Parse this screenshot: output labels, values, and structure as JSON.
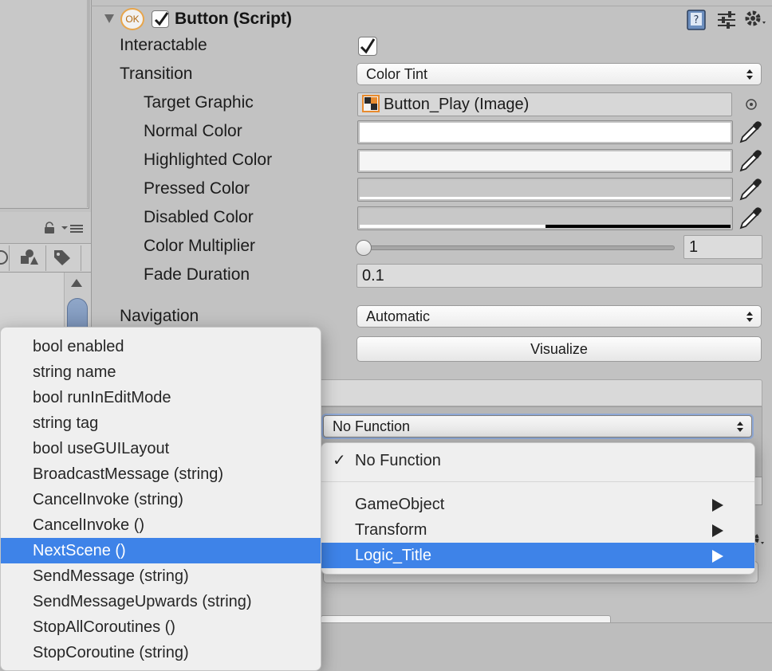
{
  "component": {
    "title": "Button (Script)",
    "enabled": true,
    "ok_badge": "OK"
  },
  "fields": {
    "interactable_label": "Interactable",
    "interactable_checked": true,
    "transition_label": "Transition",
    "transition_value": "Color Tint",
    "target_graphic_label": "Target Graphic",
    "target_graphic_value": "Button_Play (Image)",
    "normal_color_label": "Normal Color",
    "normal_color": "#ffffff",
    "highlighted_color_label": "Highlighted Color",
    "highlighted_color": "#f5f5f5",
    "pressed_color_label": "Pressed Color",
    "pressed_color": "#c8c8c8",
    "disabled_color_label": "Disabled Color",
    "disabled_color": "#c8c8c8",
    "color_multiplier_label": "Color Multiplier",
    "color_multiplier_value": "1",
    "fade_duration_label": "Fade Duration",
    "fade_duration_value": "0.1",
    "navigation_label": "Navigation",
    "navigation_value": "Automatic",
    "visualize_label": "Visualize"
  },
  "on_click": {
    "function_value": "No Function"
  },
  "function_menu": {
    "items": [
      {
        "label": "No Function",
        "checked": true
      },
      {
        "label": "GameObject",
        "submenu": true
      },
      {
        "label": "Transform",
        "submenu": true
      },
      {
        "label": "Logic_Title",
        "submenu": true,
        "selected": true
      }
    ]
  },
  "method_menu": {
    "items": [
      "bool enabled",
      "string name",
      "bool runInEditMode",
      "string tag",
      "bool useGUILayout",
      "BroadcastMessage (string)",
      "CancelInvoke (string)",
      "CancelInvoke ()",
      "NextScene ()",
      "SendMessage (string)",
      "SendMessageUpwards (string)",
      "StopAllCoroutines ()",
      "StopCoroutine (string)"
    ],
    "selected_index": 8
  },
  "colors": {
    "selection": "#3e83e8",
    "ok_badge_border": "#e8a54a"
  }
}
